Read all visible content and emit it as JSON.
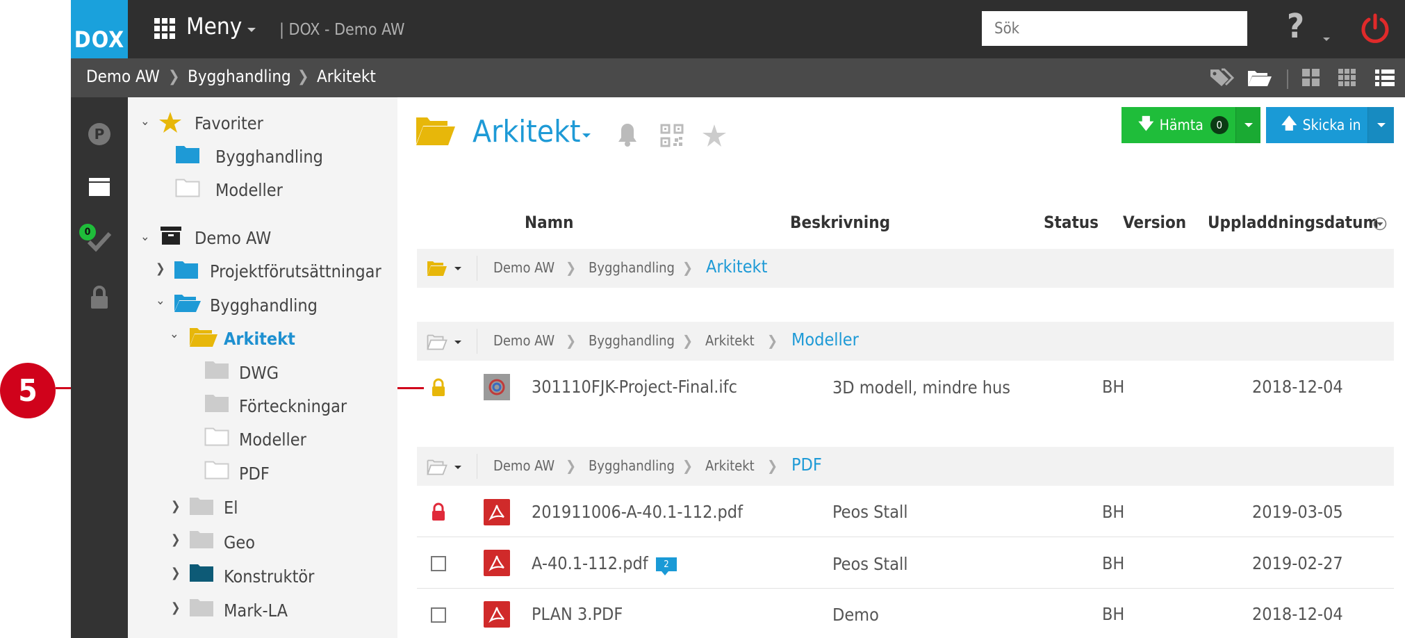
{
  "app": {
    "logo": "DOX",
    "menu_label": "Meny",
    "title": "| DOX - Demo AW",
    "search_placeholder": "Sök"
  },
  "breadcrumb": [
    "Demo AW",
    "Bygghandling",
    "Arkitekt"
  ],
  "tree": {
    "favorites": {
      "label": "Favoriter",
      "items": [
        "Bygghandling",
        "Modeller"
      ]
    },
    "root": {
      "label": "Demo AW",
      "items": [
        {
          "label": "Projektförutsättningar"
        },
        {
          "label": "Bygghandling"
        },
        {
          "label": "Arkitekt"
        },
        {
          "label": "DWG"
        },
        {
          "label": "Förteckningar"
        },
        {
          "label": "Modeller"
        },
        {
          "label": "PDF"
        },
        {
          "label": "El"
        },
        {
          "label": "Geo"
        },
        {
          "label": "Konstruktör"
        },
        {
          "label": "Mark-LA"
        }
      ]
    }
  },
  "rail": {
    "badge": "0"
  },
  "main": {
    "title": "Arkitekt",
    "hamta": {
      "label": "Hämta",
      "count": "0"
    },
    "skicka": {
      "label": "Skicka in"
    },
    "columns": [
      "Namn",
      "Beskrivning",
      "Status",
      "Version",
      "Uppladdningsdatum"
    ],
    "groups": [
      {
        "crumbs": [
          "Demo AW",
          "Bygghandling"
        ],
        "active": "Arkitekt"
      },
      {
        "crumbs": [
          "Demo AW",
          "Bygghandling",
          "Arkitekt"
        ],
        "active": "Modeller"
      },
      {
        "crumbs": [
          "Demo AW",
          "Bygghandling",
          "Arkitekt"
        ],
        "active": "PDF"
      }
    ],
    "files": [
      {
        "name": "301110FJK-Project-Final.ifc",
        "desc": "3D modell, mindre hus",
        "status": "BH",
        "date": "2018-12-04"
      },
      {
        "name": "201911006-A-40.1-112.pdf",
        "desc": "Peos Stall",
        "status": "BH",
        "date": "2019-03-05"
      },
      {
        "name": "A-40.1-112.pdf",
        "desc": "Peos Stall",
        "status": "BH",
        "date": "2019-02-27",
        "comments": "2"
      },
      {
        "name": "PLAN 3.PDF",
        "desc": "Demo",
        "status": "BH",
        "date": "2018-12-04"
      }
    ]
  },
  "callout": {
    "number": "5"
  },
  "colors": {
    "brand": "#1aa1dc",
    "green": "#1fbd3a",
    "blue": "#1a9ad6",
    "red": "#d0021b",
    "folder_yellow": "#e7b70a"
  }
}
